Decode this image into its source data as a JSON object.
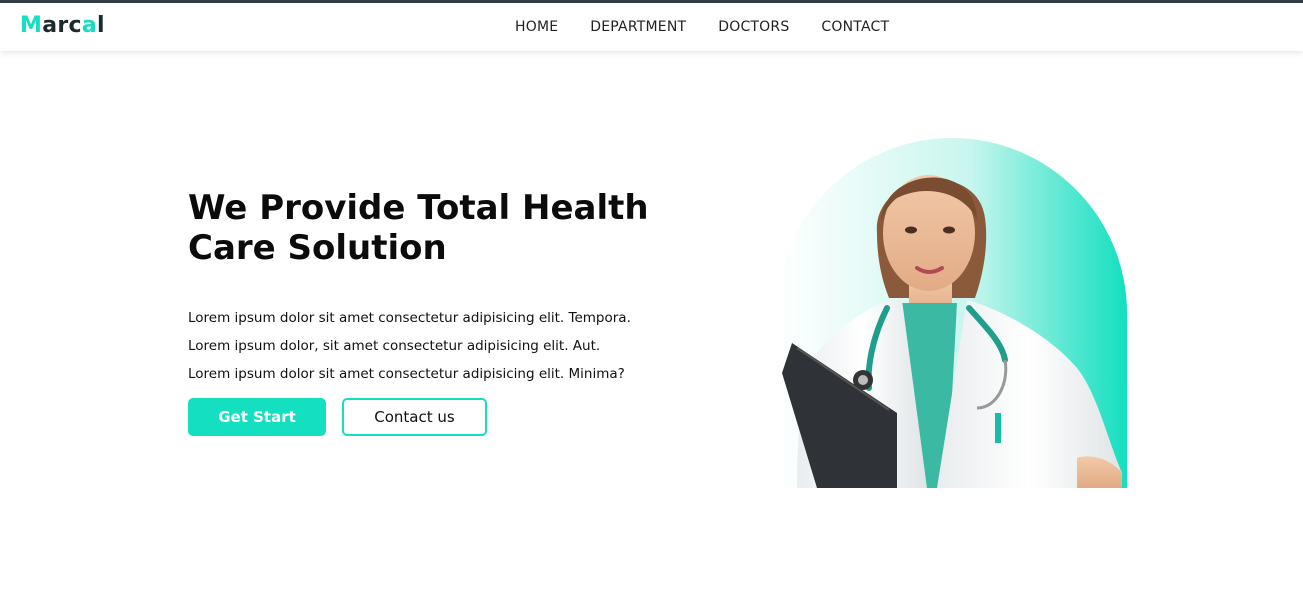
{
  "brand": {
    "logo_parts": [
      "M",
      "arc",
      "a",
      "l"
    ],
    "accent_color": "#14dfc0",
    "dark_color": "#1c2a30"
  },
  "nav": {
    "items": [
      {
        "label": "HOME"
      },
      {
        "label": "DEPARTMENT"
      },
      {
        "label": "DOCTORS"
      },
      {
        "label": "CONTACT"
      }
    ]
  },
  "hero": {
    "title_line1": "We Provide Total Health",
    "title_line2": "Care Solution",
    "lines": [
      "Lorem ipsum dolor sit amet consectetur adipisicing elit. Tempora.",
      "Lorem ipsum dolor, sit amet consectetur adipisicing elit. Aut.",
      "Lorem ipsum dolor sit amet consectetur adipisicing elit. Minima?"
    ],
    "primary_button": "Get Start",
    "secondary_button": "Contact us"
  },
  "image": {
    "icon": "doctor-illustration"
  }
}
